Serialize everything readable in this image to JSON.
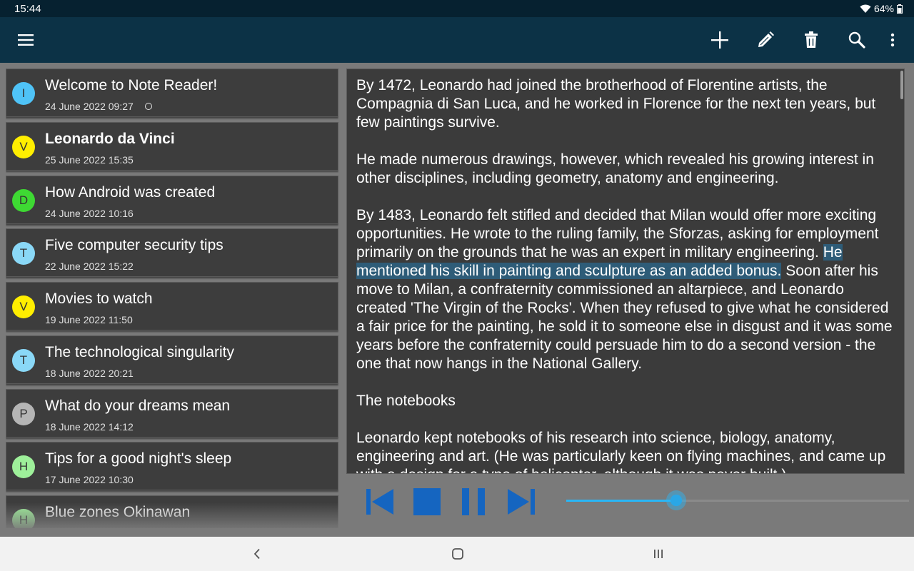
{
  "status": {
    "time": "15:44",
    "battery": "64%"
  },
  "appbar": {
    "icons": [
      "menu-icon",
      "add-icon",
      "edit-icon",
      "delete-icon",
      "search-icon",
      "more-vert-icon"
    ]
  },
  "notes": [
    {
      "initial": "I",
      "title": "Welcome to Note Reader!",
      "date": "24 June 2022 09:27",
      "color": "#4fc3f7",
      "bold": false,
      "ring": true
    },
    {
      "initial": "V",
      "title": "Leonardo da Vinci",
      "date": "25 June 2022 15:35",
      "color": "#ffee00",
      "bold": true,
      "ring": false
    },
    {
      "initial": "D",
      "title": "How Android was created",
      "date": "24 June 2022 10:16",
      "color": "#3ed933",
      "bold": false,
      "ring": false
    },
    {
      "initial": "T",
      "title": "Five computer security tips",
      "date": "22 June 2022 15:22",
      "color": "#8ad8f7",
      "bold": false,
      "ring": false
    },
    {
      "initial": "V",
      "title": "Movies to watch",
      "date": "19 June 2022 11:50",
      "color": "#ffee00",
      "bold": false,
      "ring": false
    },
    {
      "initial": "T",
      "title": "The technological singularity",
      "date": "18 June 2022 20:21",
      "color": "#8ad8f7",
      "bold": false,
      "ring": false
    },
    {
      "initial": "P",
      "title": "What do your dreams mean",
      "date": "18 June 2022 14:12",
      "color": "#b5b5b5",
      "bold": false,
      "ring": false
    },
    {
      "initial": "H",
      "title": "Tips for a good night's sleep",
      "date": "17 June 2022 10:30",
      "color": "#9ef09a",
      "bold": false,
      "ring": false
    },
    {
      "initial": "H",
      "title": "Blue zones Okinawan",
      "date": "",
      "color": "#9ef09a",
      "bold": false,
      "ring": false
    }
  ],
  "reader": {
    "p1": "By 1472, Leonardo had joined the brotherhood of Florentine artists, the Compagnia di San Luca, and he worked in Florence for the next ten years, but few paintings survive.",
    "p2": "He made numerous drawings, however, which revealed his growing interest in other disciplines, including geometry, anatomy and engineering.",
    "p3_before": "By 1483, Leonardo felt stifled and decided that Milan would offer more exciting opportunities. He wrote to the ruling family, the Sforzas, asking for employment primarily on the grounds that he was an expert in military engineering. ",
    "p3_highlight": "He mentioned his skill in painting and sculpture as an added bonus.",
    "p3_after": " Soon after his move to Milan, a confraternity commissioned an altarpiece, and Leonardo created 'The Virgin of the Rocks'. When they refused to give what he considered a fair price for the painting, he sold it to someone else in disgust and it was some years before the confraternity could persuade him to do a second version - the one that now hangs in the National Gallery.",
    "p4": "The notebooks",
    "p5": "Leonardo kept notebooks of his research into science, biology, anatomy, engineering and art. (He was particularly keen on flying machines, and came up with a design for a type of helicopter, although it was never built.)"
  },
  "player": {
    "icons": [
      "skip-previous-icon",
      "stop-icon",
      "pause-icon",
      "skip-next-icon"
    ],
    "progress": 0.32,
    "accent": "#1565c0"
  },
  "navbar": {
    "icons": [
      "back-icon",
      "home-icon",
      "recents-icon"
    ]
  }
}
